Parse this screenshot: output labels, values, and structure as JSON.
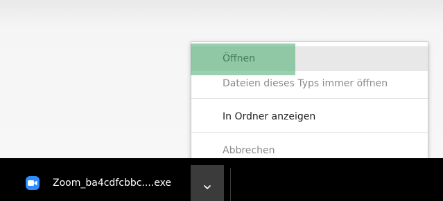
{
  "download_bar": {
    "file_name": "Zoom_ba4cdfcbbc....exe",
    "file_icon": "zoom-camera-icon",
    "menu_button_icon": "chevron-down-icon"
  },
  "context_menu": {
    "items": [
      {
        "label": "Öffnen",
        "state": "highlighted"
      },
      {
        "label": "Dateien dieses Typs immer öffnen",
        "state": "disabled"
      },
      {
        "label": "In Ordner anzeigen",
        "state": "enabled"
      },
      {
        "label": "Abbrechen",
        "state": "disabled"
      }
    ]
  },
  "colors": {
    "download_bar": "#000000",
    "zoom_icon": "#2d8cff",
    "menu_highlight": "#e8e8e8",
    "green_overlay": "#5ab47d"
  }
}
